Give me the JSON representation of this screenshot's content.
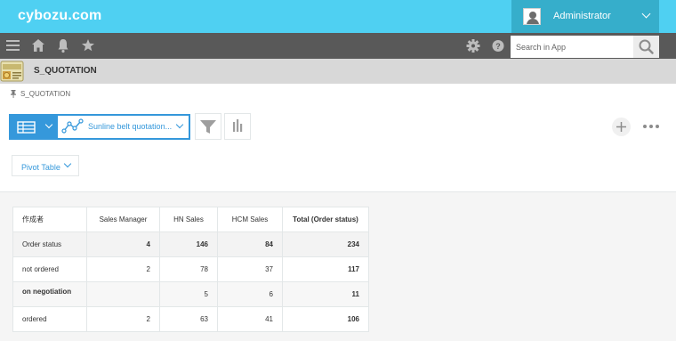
{
  "header": {
    "logo": "cybozu.com",
    "user_name": "Administrator"
  },
  "nav": {
    "search_placeholder": "Search in App",
    "icons": [
      "hamburger-icon",
      "home-icon",
      "bell-icon",
      "star-icon",
      "gear-icon",
      "help-icon",
      "search-icon"
    ]
  },
  "app": {
    "title": "S_QUOTATION",
    "breadcrumb": "S_QUOTATION"
  },
  "toolbar": {
    "view_name": "Sunline belt quotation...",
    "pivot_label": "Pivot Table"
  },
  "pivot": {
    "corner": "作成者",
    "columns": [
      "Sales Manager",
      "HN Sales",
      "HCM Sales",
      "Total (Order status)"
    ],
    "rows": [
      {
        "label": "Order status",
        "values": [
          "4",
          "146",
          "84",
          "234"
        ]
      },
      {
        "label": "not ordered",
        "values": [
          "2",
          "78",
          "37",
          "117"
        ]
      },
      {
        "label": "on negotiation",
        "values": [
          "",
          "5",
          "6",
          "11"
        ]
      },
      {
        "label": "ordered",
        "values": [
          "2",
          "63",
          "41",
          "106"
        ]
      }
    ]
  },
  "colors": {
    "topbar": "#4fd0f2",
    "user_area": "#36aecb",
    "navbar": "#595959",
    "accent": "#3598db",
    "app_header": "#d8d8d8"
  }
}
